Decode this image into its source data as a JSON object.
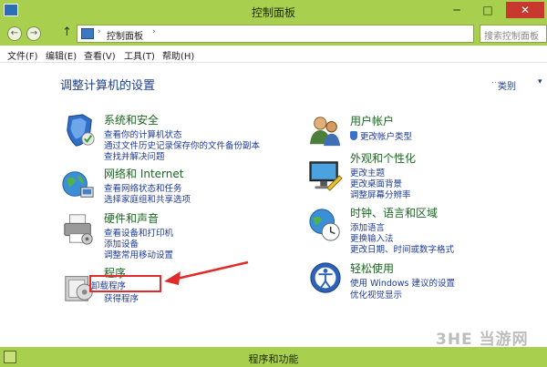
{
  "window": {
    "title": "控制面板",
    "min_glyph": "─",
    "max_glyph": "□",
    "close_glyph": "✕"
  },
  "nav": {
    "back_glyph": "←",
    "forward_glyph": "→",
    "up_glyph": "↑",
    "sep": "›",
    "breadcrumb": "控制面板",
    "search_placeholder": "搜索控制面板"
  },
  "menu": [
    "文件(F)",
    "编辑(E)",
    "查看(V)",
    "工具(T)",
    "帮助(H)"
  ],
  "content": {
    "heading": "调整计算机的设置",
    "view_by_label": "类别",
    "view_by_caret": "▾",
    "categories": [
      {
        "title": "系统和安全",
        "icon": "shield-check-icon",
        "links": [
          "查看你的计算机状态",
          "通过文件历史记录保存你的文件备份副本",
          "查找并解决问题"
        ]
      },
      {
        "title": "网络和 Internet",
        "icon": "globe-network-icon",
        "links": [
          "查看网络状态和任务",
          "选择家庭组和共享选项"
        ]
      },
      {
        "title": "硬件和声音",
        "icon": "printer-icon",
        "links": [
          "查看设备和打印机",
          "添加设备",
          "调整常用移动设置"
        ]
      },
      {
        "title": "程序",
        "icon": "programs-box-icon",
        "links": [
          "卸载程序",
          "获得程序"
        ]
      },
      {
        "title": "用户帐户",
        "icon": "users-icon",
        "links": [
          "更改帐户类型"
        ]
      },
      {
        "title": "外观和个性化",
        "icon": "monitor-paint-icon",
        "links": [
          "更改主题",
          "更改桌面背景",
          "调整屏幕分辨率"
        ]
      },
      {
        "title": "时钟、语言和区域",
        "icon": "clock-globe-icon",
        "links": [
          "添加语言",
          "更换输入法",
          "更改日期、时间或数字格式"
        ]
      },
      {
        "title": "轻松使用",
        "icon": "ease-of-access-icon",
        "links": [
          "使用 Windows 建议的设置",
          "优化视觉显示"
        ]
      }
    ]
  },
  "status": {
    "text": "程序和功能"
  },
  "watermark": "3HE 当游网",
  "colors": {
    "chrome": "#a9cf4f",
    "link": "#1e3b99",
    "category": "#1a6620",
    "highlight": "#e12b2b"
  }
}
